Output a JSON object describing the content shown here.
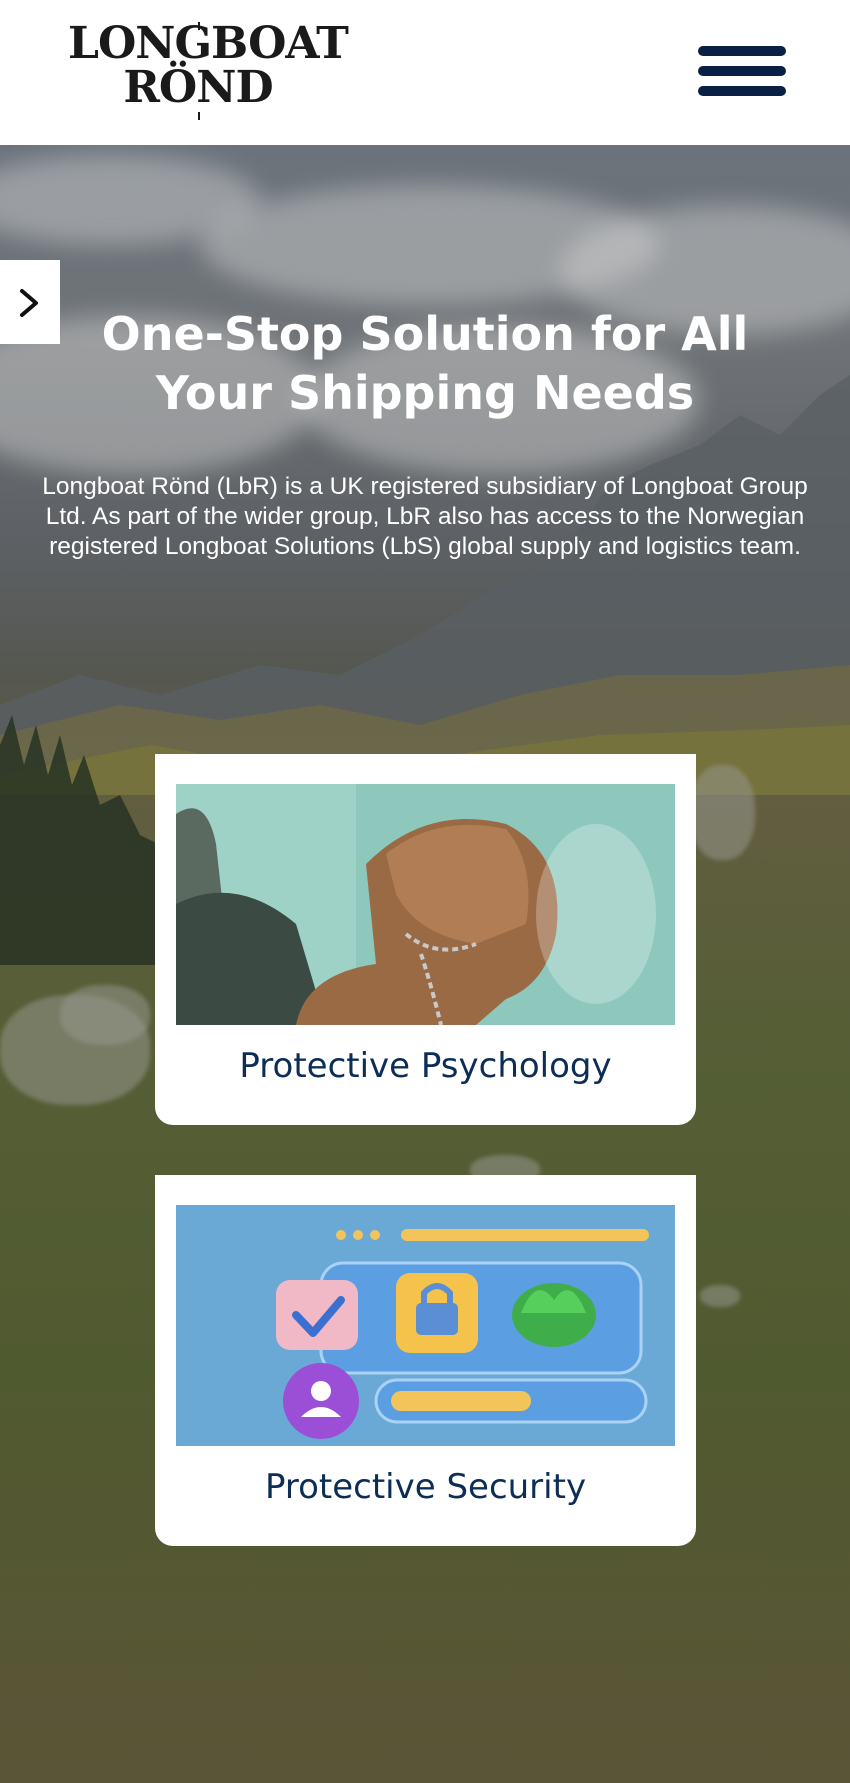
{
  "header": {
    "logo_line1": "LONGBOAT",
    "logo_line2": "RÖND",
    "menu_icon": "hamburger-menu-icon"
  },
  "hero": {
    "title": "One-Stop Solution for All Your Shipping Needs",
    "description": "Longboat Rönd (LbR) is a UK registered subsidiary of Longboat Group Ltd. As part of the wider group, LbR also has access to the Norwegian registered Longboat Solutions (LbS) global supply and logistics team.",
    "side_arrow_icon": "chevron-right-icon"
  },
  "cards": [
    {
      "label": "Protective Psychology"
    },
    {
      "label": "Protective Security"
    }
  ],
  "colors": {
    "brand_navy": "#0a1f44",
    "card_text": "#0c2d55"
  }
}
